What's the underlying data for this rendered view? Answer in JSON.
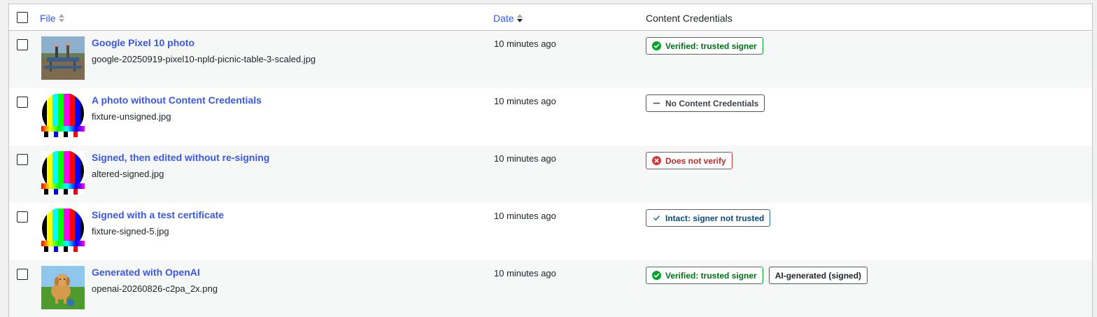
{
  "header": {
    "col_file": "File",
    "col_date": "Date",
    "col_credentials": "Content Credentials"
  },
  "rows": [
    {
      "title": "Google Pixel 10 photo",
      "filename": "google-20250919-pixel10-npld-picnic-table-3-scaled.jpg",
      "date": "10 minutes ago",
      "thumb": "photo-picnic-table",
      "badges": [
        {
          "label": "Verified: trusted signer",
          "style": "green",
          "icon": "check-circle-icon"
        }
      ]
    },
    {
      "title": "A photo without Content Credentials",
      "filename": "fixture-unsigned.jpg",
      "date": "10 minutes ago",
      "thumb": "test-pattern",
      "badges": [
        {
          "label": "No Content Credentials",
          "style": "gray",
          "icon": "dash-icon"
        }
      ]
    },
    {
      "title": "Signed, then edited without re-signing",
      "filename": "altered-signed.jpg",
      "date": "10 minutes ago",
      "thumb": "test-pattern",
      "badges": [
        {
          "label": "Does not verify",
          "style": "red",
          "icon": "x-circle-icon"
        }
      ]
    },
    {
      "title": "Signed with a test certificate",
      "filename": "fixture-signed-5.jpg",
      "date": "10 minutes ago",
      "thumb": "test-pattern",
      "badges": [
        {
          "label": "Intact: signer not trusted",
          "style": "blue",
          "icon": "checkmark-icon"
        }
      ]
    },
    {
      "title": "Generated with OpenAI",
      "filename": "openai-20260826-c2pa_2x.png",
      "date": "10 minutes ago",
      "thumb": "photo-dog-grass",
      "badges": [
        {
          "label": "Verified: trusted signer",
          "style": "green",
          "icon": "check-circle-icon"
        },
        {
          "label": "AI-generated (signed)",
          "style": "plain",
          "icon": ""
        }
      ]
    }
  ],
  "colors": {
    "link": "#3858e9",
    "green": "#007017",
    "red": "#b32d2e",
    "blue": "#0a4b78",
    "gray": "#3c434a"
  }
}
